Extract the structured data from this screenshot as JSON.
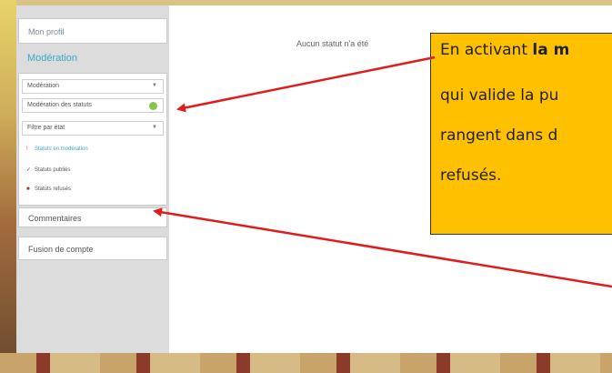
{
  "sidebar": {
    "profile_label": "Mon profil",
    "moderation_title": "Modération",
    "moderation_select": "Modération",
    "moderation_toggle_label": "Modération des statuts",
    "filter_select": "Filtre par état",
    "filters": [
      {
        "label": "Statuts en modération",
        "icon": "info-icon"
      },
      {
        "label": "Statuts publiés",
        "icon": "check-icon"
      },
      {
        "label": "Statuts refusés",
        "icon": "square-icon"
      }
    ],
    "comments_label": "Commentaires",
    "fusion_label": "Fusion de compte"
  },
  "main": {
    "status_text": "Aucun statut n'a été"
  },
  "callout": {
    "line1_prefix": "En activant ",
    "line1_bold": "la m",
    "line2": "qui valide la pu",
    "line3": "rangent dans d",
    "line4": "refusés."
  },
  "colors": {
    "callout_bg": "#ffc000",
    "arrow": "#e01b1b",
    "accent": "#3aa7c9",
    "toggle": "#8bc34a"
  }
}
